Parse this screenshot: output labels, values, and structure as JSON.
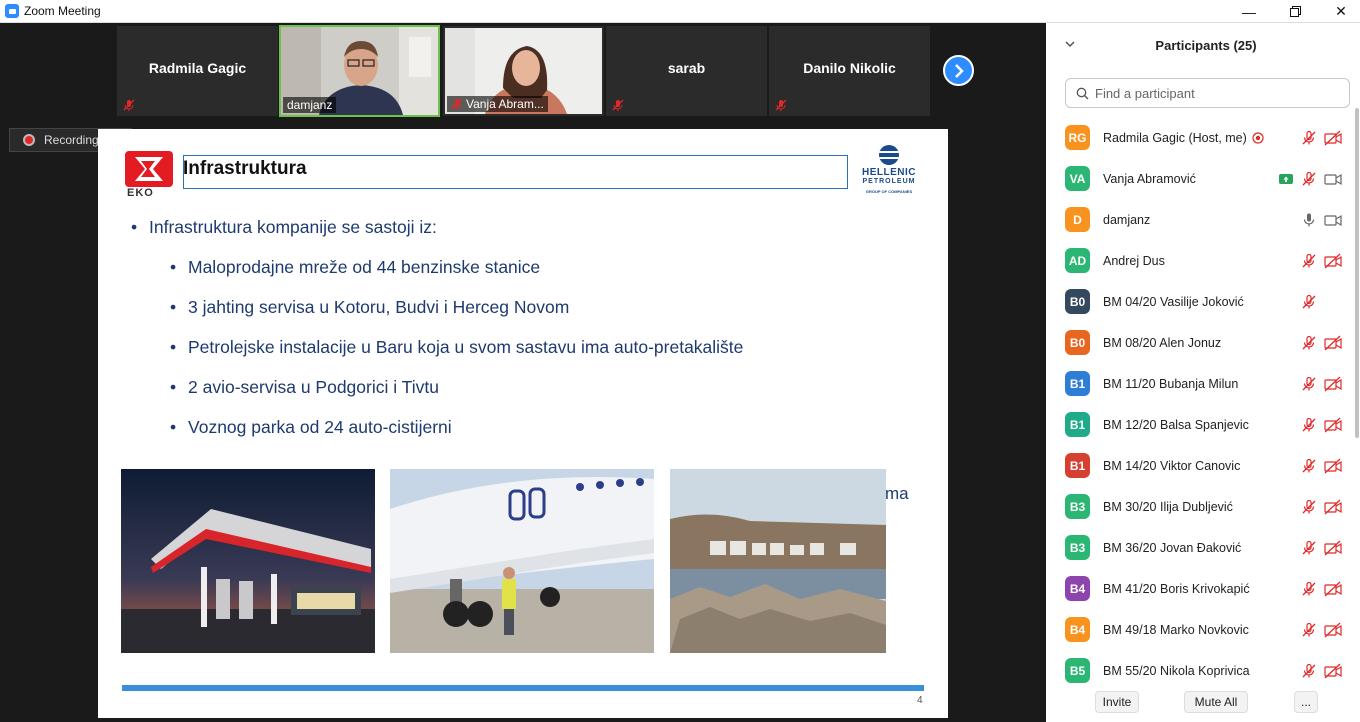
{
  "window": {
    "title": "Zoom Meeting"
  },
  "video_strip": {
    "tiles": [
      {
        "name": "Radmila Gagic",
        "type": "name"
      },
      {
        "name": "damjanz",
        "type": "video"
      },
      {
        "name": "Vanja Abram...",
        "type": "video"
      },
      {
        "name": "sarab",
        "type": "name"
      },
      {
        "name": "Danilo Nikolic",
        "type": "name"
      }
    ]
  },
  "recording": {
    "label": "Recording..."
  },
  "slide": {
    "logo_left": "EKO",
    "title": "Infrastruktura",
    "logo_right": {
      "line1": "HELLENIC",
      "line2": "PETROLEUM",
      "line3": "GROUP OF COMPANIES"
    },
    "main_bullet": "Infrastruktura kompanije se sastoji iz:",
    "sub_bullets": [
      "Maloprodajne mreže od 44 benzinske stanice",
      "3 jahting servisa u Kotoru, Budvi i Herceg Novom",
      "Petrolejske instalacije u Baru koja u svom sastavu ima auto-pretakalište",
      "2 avio-servisa u Podgorici i Tivtu",
      "Voznog parka od 24 auto-cistijerni"
    ],
    "trailing_text": "ma",
    "page_number": "4"
  },
  "participants": {
    "title": "Participants (25)",
    "search_placeholder": "Find a participant",
    "list": [
      {
        "initials": "RG",
        "name": "Radmila Gagic (Host, me)",
        "color": "#f7931e",
        "rec": true
      },
      {
        "initials": "VA",
        "name": "Vanja Abramović",
        "color": "#2bb673",
        "share": true
      },
      {
        "initials": "D",
        "name": "damjanz",
        "color": "#f7931e",
        "mic_on": true
      },
      {
        "initials": "AD",
        "name": "Andrej Dus",
        "color": "#2bb673"
      },
      {
        "initials": "B0",
        "name": "BM 04/20 Vasilije Joković",
        "color": "#34495e",
        "no_video_icon": true
      },
      {
        "initials": "B0",
        "name": "BM 08/20 Alen Jonuz",
        "color": "#e8661f"
      },
      {
        "initials": "B1",
        "name": "BM 11/20 Bubanja Milun",
        "color": "#2e7ed6"
      },
      {
        "initials": "B1",
        "name": "BM 12/20 Balsa Spanjevic",
        "color": "#1fab89"
      },
      {
        "initials": "B1",
        "name": "BM 14/20 Viktor Canovic",
        "color": "#d64031"
      },
      {
        "initials": "B3",
        "name": "BM 30/20 Ilija Dubljević",
        "color": "#2bb673"
      },
      {
        "initials": "B3",
        "name": "BM 36/20 Jovan Đaković",
        "color": "#2bb673"
      },
      {
        "initials": "B4",
        "name": "BM 41/20 Boris Krivokapić",
        "color": "#8e44ad"
      },
      {
        "initials": "B4",
        "name": "BM 49/18 Marko Novkovic",
        "color": "#f7931e"
      },
      {
        "initials": "B5",
        "name": "BM 55/20 Nikola Koprivica",
        "color": "#2bb673"
      }
    ],
    "buttons": {
      "invite": "Invite",
      "mute_all": "Mute All",
      "more": "..."
    }
  }
}
